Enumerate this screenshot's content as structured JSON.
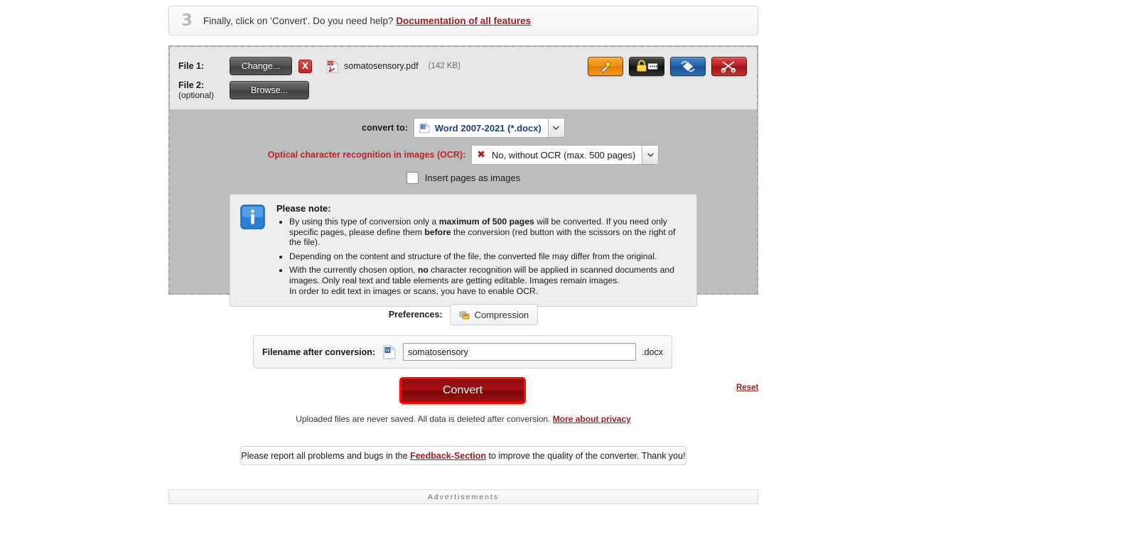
{
  "step": {
    "number": "3",
    "text_before": "Finally, click on 'Convert'. Do you need help?",
    "doc_link": "Documentation of all features"
  },
  "files": {
    "file1_label": "File 1:",
    "change_button": "Change...",
    "remove_button": "X",
    "file_name": "somatosensory.pdf",
    "file_size": "(142 KB)",
    "file2_label": "File 2:",
    "file2_sub": "(optional)",
    "browse_button": "Browse...",
    "tools": [
      {
        "name": "magic-wand-icon",
        "title": "Improve / optimize"
      },
      {
        "name": "lock-password-icon",
        "title": "Password protection"
      },
      {
        "name": "rotate-pages-icon",
        "title": "Rotate pages"
      },
      {
        "name": "scissors-split-icon",
        "title": "Split / select pages"
      }
    ]
  },
  "options": {
    "convert_to_label": "convert to:",
    "convert_to_value": "Word 2007-2021 (*.docx)",
    "ocr_label": "Optical character recognition in images (OCR):",
    "ocr_value": "No, without OCR (max. 500 pages)",
    "ocr_mark": "✖",
    "insert_pages_label": "Insert pages as images",
    "insert_pages_checked": false,
    "dropdown_arrow": "⌵"
  },
  "note": {
    "title": "Please note:",
    "items": [
      {
        "parts": [
          {
            "t": "By using this type of conversion only a ",
            "b": false
          },
          {
            "t": "maximum of 500 pages",
            "b": true
          },
          {
            "t": " will be converted. If you need only specific pages, please define them ",
            "b": false
          },
          {
            "t": "before",
            "b": true
          },
          {
            "t": " the conversion (red button with the scissors on the right of the file).",
            "b": false
          }
        ]
      },
      {
        "parts": [
          {
            "t": "Depending on the content and structure of the file, the converted file may differ from the original.",
            "b": false
          }
        ]
      },
      {
        "parts": [
          {
            "t": "With the currently chosen option, ",
            "b": false
          },
          {
            "t": "no",
            "b": true
          },
          {
            "t": " character recognition will be applied in scanned documents and images. Only real text and table elements are getting editable. Images remain images.",
            "b": false
          },
          {
            "t": "\nIn order to edit text in images or scans, you have to enable OCR.",
            "b": false
          }
        ]
      }
    ]
  },
  "preferences": {
    "label": "Preferences:",
    "compression_button": "Compression"
  },
  "filename": {
    "label": "Filename after conversion:",
    "value": "somatosensory",
    "placeholder": "",
    "extension": ".docx"
  },
  "actions": {
    "convert_button": "Convert",
    "reset_link": "Reset",
    "privacy_text": "Uploaded files are never saved. All data is deleted after conversion.",
    "privacy_link": "More about privacy"
  },
  "feedback": {
    "before": "Please report all problems and bugs in the",
    "link": "Feedback-Section",
    "after": "to improve the quality of the converter. Thank you!"
  },
  "ads": {
    "label": "Advertisements"
  },
  "colors": {
    "accent_red": "#a02020",
    "convert_border": "#f50c0c",
    "ocr_label_red": "#c0202a",
    "select_value_blue": "#1d3f7a"
  }
}
